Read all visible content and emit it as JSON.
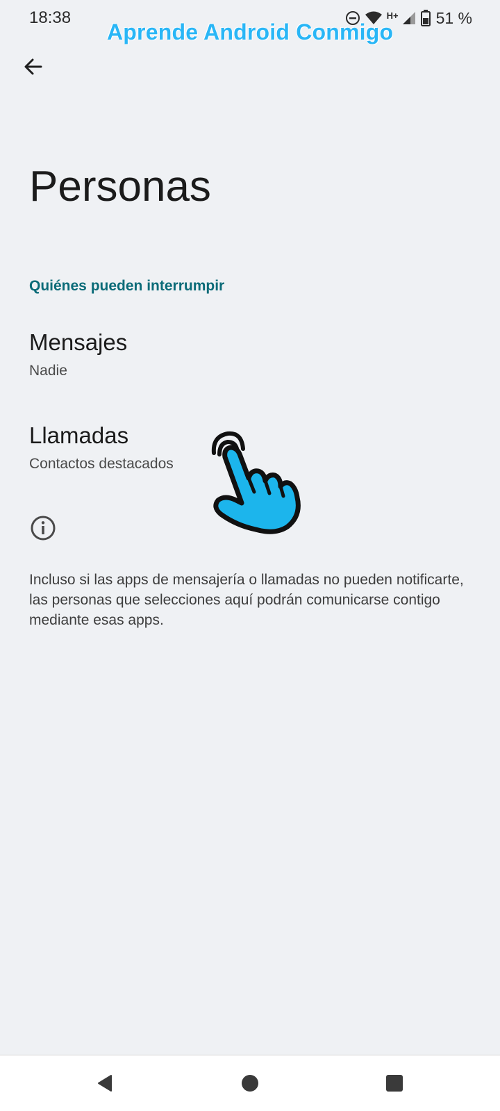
{
  "status_bar": {
    "time": "18:38",
    "network_type": "H+",
    "battery_percent": "51 %"
  },
  "watermark": "Aprende Android Conmigo",
  "header": {
    "title": "Personas"
  },
  "section": {
    "header": "Quiénes pueden interrumpir"
  },
  "items": [
    {
      "title": "Mensajes",
      "summary": "Nadie"
    },
    {
      "title": "Llamadas",
      "summary": "Contactos destacados"
    }
  ],
  "footer": {
    "info_icon": "info-icon",
    "text": "Incluso si las apps de mensajería o llamadas no pueden notificarte, las personas que selecciones aquí podrán comunicarse contigo mediante esas apps."
  },
  "colors": {
    "background": "#eff1f4",
    "section_header": "#0b6b78",
    "watermark": "#29b6f6",
    "hand": "#1cb5ec"
  },
  "navigation": {
    "back": "nav-back-icon",
    "home": "nav-home-icon",
    "recents": "nav-recents-icon"
  }
}
